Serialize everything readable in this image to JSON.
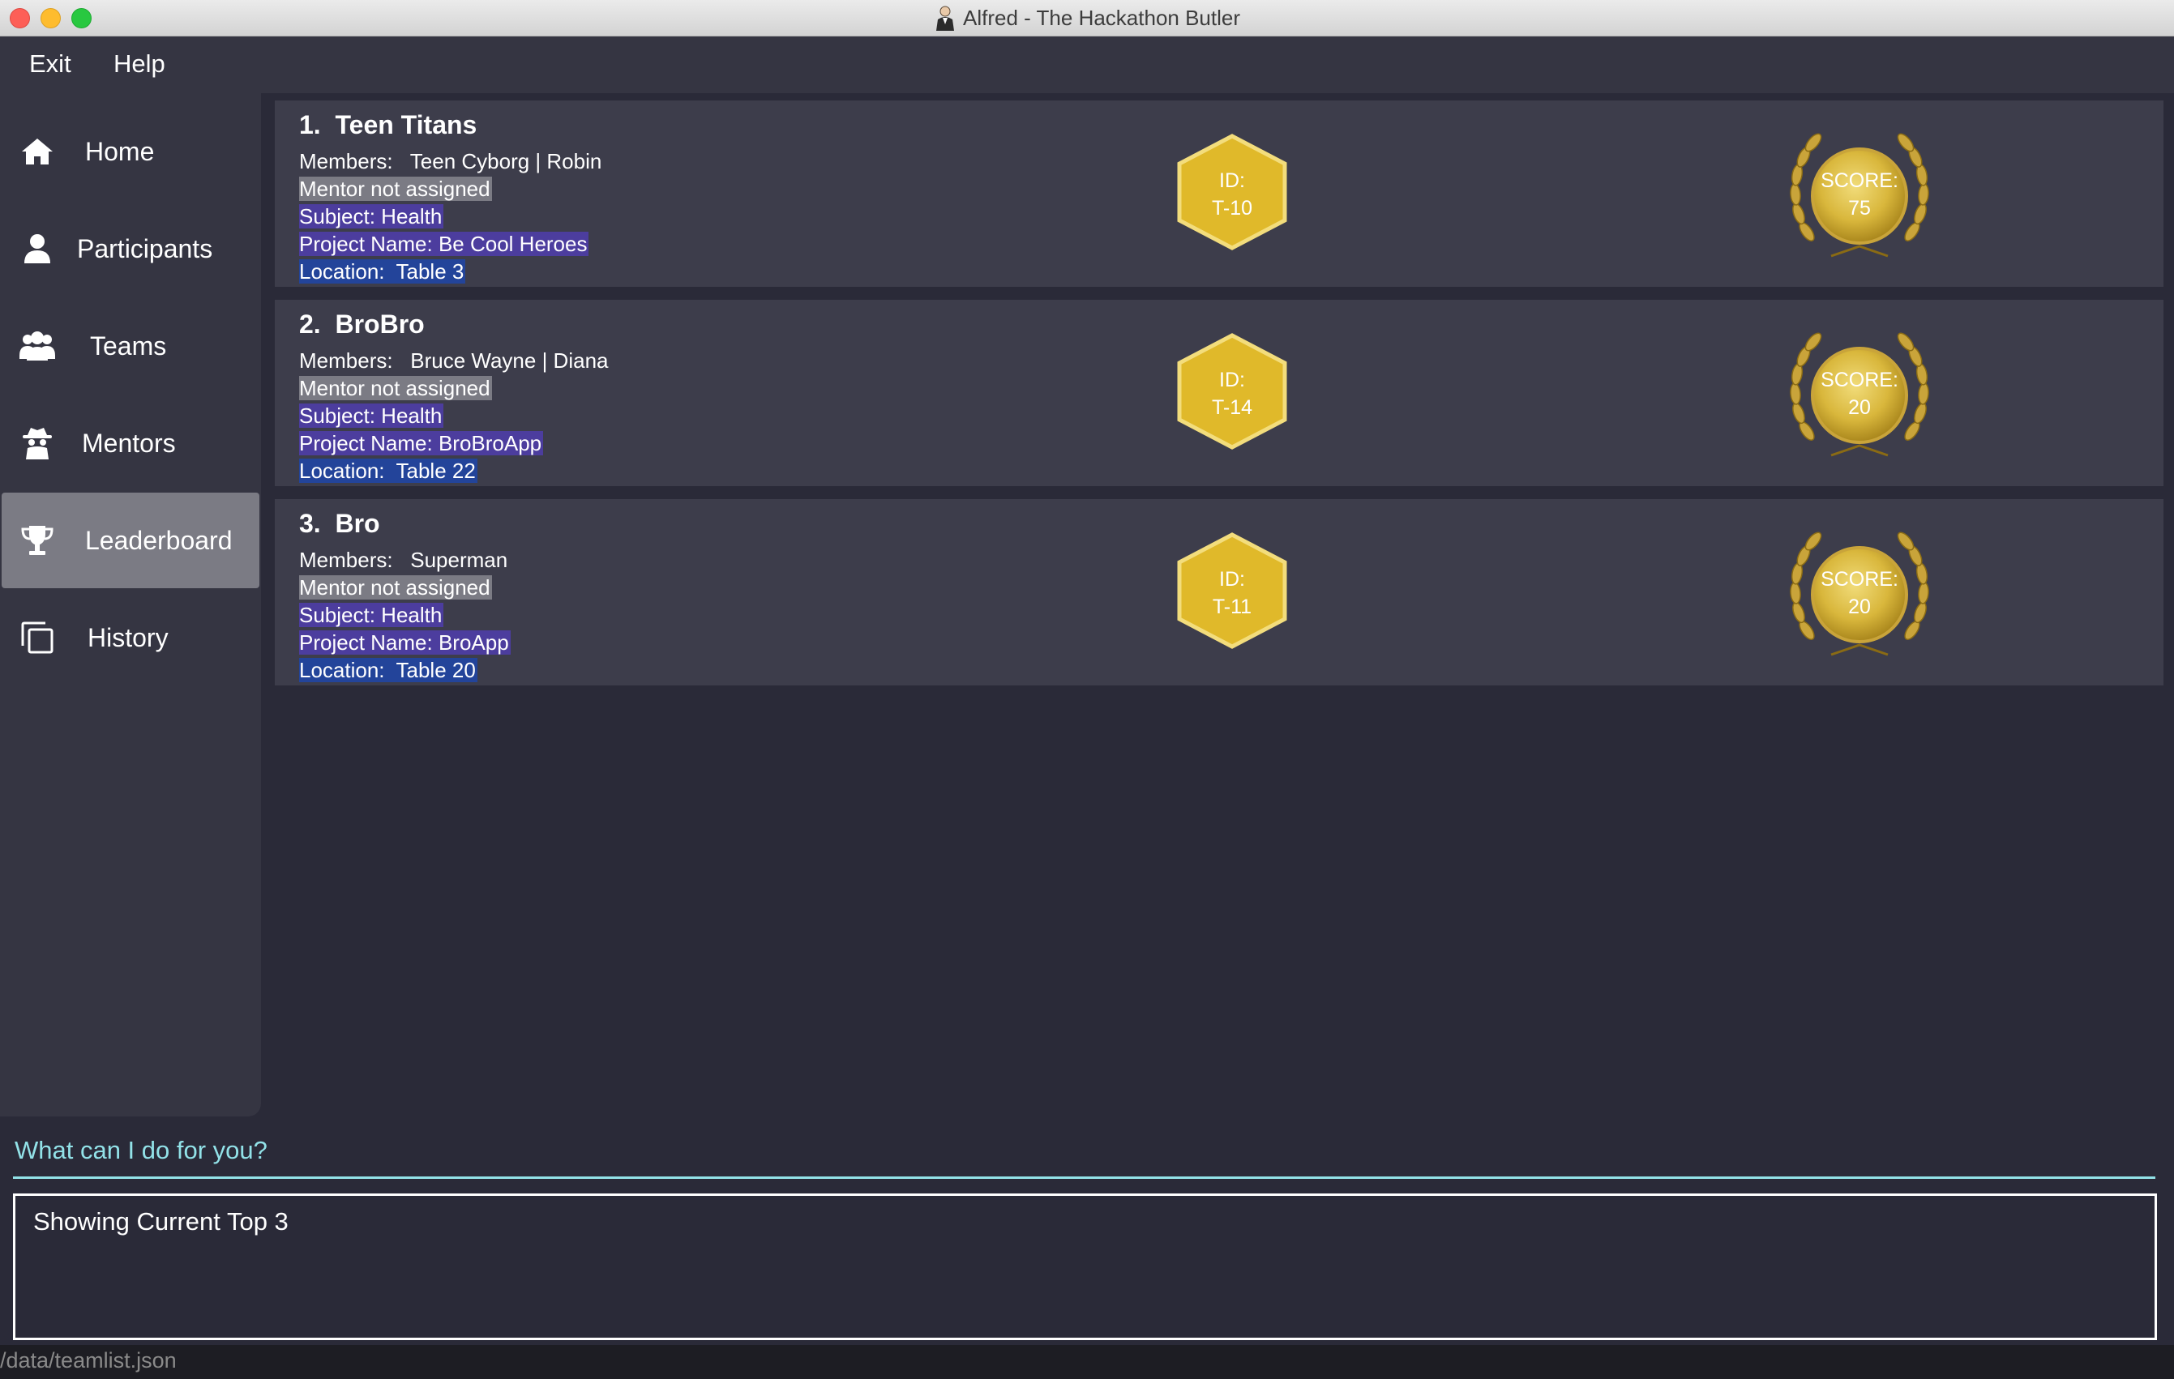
{
  "window": {
    "title": "Alfred - The Hackathon Butler"
  },
  "menu": {
    "exit": "Exit",
    "help": "Help"
  },
  "sidebar": {
    "items": [
      {
        "label": "Home",
        "icon": "home-icon"
      },
      {
        "label": "Participants",
        "icon": "user-icon"
      },
      {
        "label": "Teams",
        "icon": "users-icon"
      },
      {
        "label": "Mentors",
        "icon": "spy-icon"
      },
      {
        "label": "Leaderboard",
        "icon": "trophy-icon",
        "active": true
      },
      {
        "label": "History",
        "icon": "history-icon"
      }
    ]
  },
  "teams": [
    {
      "rank": "1.",
      "name": "Teen Titans",
      "members_label": "Members:",
      "members": "Teen Cyborg | Robin",
      "mentor": "Mentor not assigned",
      "subject": "Subject: Health",
      "project": "Project Name: Be Cool Heroes",
      "location": "Location:  Table 3",
      "id_label": "ID:",
      "id": "T-10",
      "score_label": "SCORE:",
      "score": "75"
    },
    {
      "rank": "2.",
      "name": "BroBro",
      "members_label": "Members:",
      "members": "Bruce Wayne | Diana",
      "mentor": "Mentor not assigned",
      "subject": "Subject: Health",
      "project": "Project Name: BroBroApp",
      "location": "Location:  Table 22",
      "id_label": "ID:",
      "id": "T-14",
      "score_label": "SCORE:",
      "score": "20"
    },
    {
      "rank": "3.",
      "name": "Bro",
      "members_label": "Members:",
      "members": "Superman",
      "mentor": "Mentor not assigned",
      "subject": "Subject: Health",
      "project": "Project Name: BroApp",
      "location": "Location:  Table 20",
      "id_label": "ID:",
      "id": "T-11",
      "score_label": "SCORE:",
      "score": "20"
    }
  ],
  "command": {
    "prompt": "What can I do for you?"
  },
  "result": {
    "text": "Showing Current Top 3"
  },
  "status": {
    "path": "/data/teamlist.json"
  },
  "colors": {
    "background": "#2a2a38",
    "sidebar": "#353542",
    "card": "#3d3d4b",
    "active_nav": "#7b7b84",
    "accent_cyan": "#92e2e8",
    "badge_gold": "#e0b92a",
    "highlight_purple": "#4c3d9e",
    "highlight_blue": "#23449a"
  }
}
